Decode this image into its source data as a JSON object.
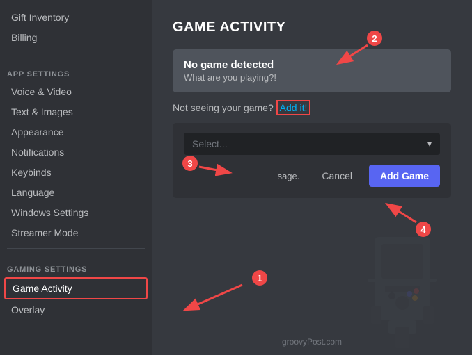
{
  "sidebar": {
    "sections": [
      {
        "label": "",
        "items": [
          {
            "id": "gift-inventory",
            "label": "Gift Inventory",
            "active": false
          },
          {
            "id": "billing",
            "label": "Billing",
            "active": false
          }
        ]
      },
      {
        "label": "APP SETTINGS",
        "items": [
          {
            "id": "voice-video",
            "label": "Voice & Video",
            "active": false
          },
          {
            "id": "text-images",
            "label": "Text & Images",
            "active": false
          },
          {
            "id": "appearance",
            "label": "Appearance",
            "active": false
          },
          {
            "id": "notifications",
            "label": "Notifications",
            "active": false
          },
          {
            "id": "keybinds",
            "label": "Keybinds",
            "active": false
          },
          {
            "id": "language",
            "label": "Language",
            "active": false
          },
          {
            "id": "windows-settings",
            "label": "Windows Settings",
            "active": false
          },
          {
            "id": "streamer-mode",
            "label": "Streamer Mode",
            "active": false
          }
        ]
      },
      {
        "label": "GAMING SETTINGS",
        "items": [
          {
            "id": "game-activity",
            "label": "Game Activity",
            "active": true
          },
          {
            "id": "overlay",
            "label": "Overlay",
            "active": false
          }
        ]
      }
    ]
  },
  "main": {
    "page_title": "GAME ACTIVITY",
    "no_game_title": "No game detected",
    "no_game_subtitle": "What are you playing?!",
    "not_seeing_text": "Not seeing your game?",
    "add_it_label": "Add it!",
    "select_placeholder": "Select...",
    "cancel_label": "Cancel",
    "add_game_label": "Add Game",
    "overlay_text": "sage.",
    "watermark": "groovyPost.com",
    "badges": [
      "2",
      "3",
      "4",
      "1"
    ]
  },
  "icons": {
    "chevron_down": "▾"
  }
}
